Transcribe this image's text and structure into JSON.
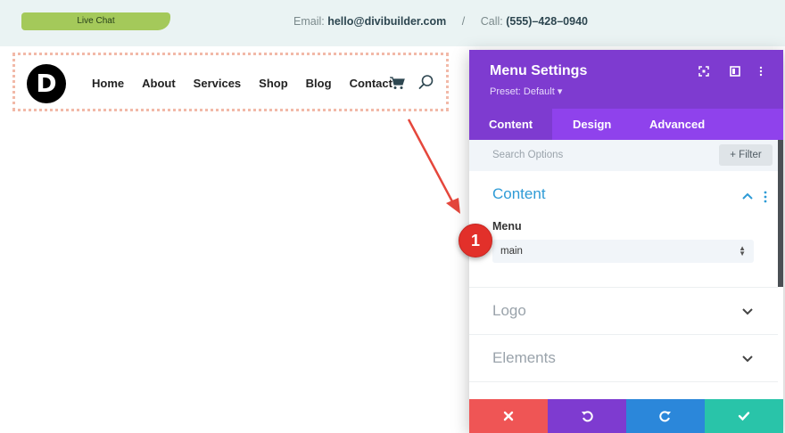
{
  "topbar": {
    "live_chat": "Live Chat",
    "email_label": "Email:",
    "email": "hello@divibuilder.com",
    "separator": "/",
    "call_label": "Call:",
    "phone": "(555)–428–0940"
  },
  "menu": {
    "logo_letter": "D",
    "items": [
      "Home",
      "About",
      "Services",
      "Shop",
      "Blog",
      "Contact"
    ]
  },
  "callout": {
    "number": "1"
  },
  "panel": {
    "title": "Menu Settings",
    "preset": "Preset: Default ▾",
    "tabs": [
      "Content",
      "Design",
      "Advanced"
    ],
    "search_placeholder": "Search Options",
    "filter_label": "+ Filter",
    "sections": {
      "content": "Content",
      "logo": "Logo",
      "elements": "Elements"
    },
    "menu_field": {
      "label": "Menu",
      "value": "main"
    }
  },
  "colors": {
    "purple_head": "#7e3bd0",
    "purple_tabs": "#8f42ec",
    "accent_blue": "#2e9bd6",
    "cancel": "#ef5555",
    "undo": "#7e3bd0",
    "redo": "#2b87da",
    "save": "#29c4a9"
  }
}
